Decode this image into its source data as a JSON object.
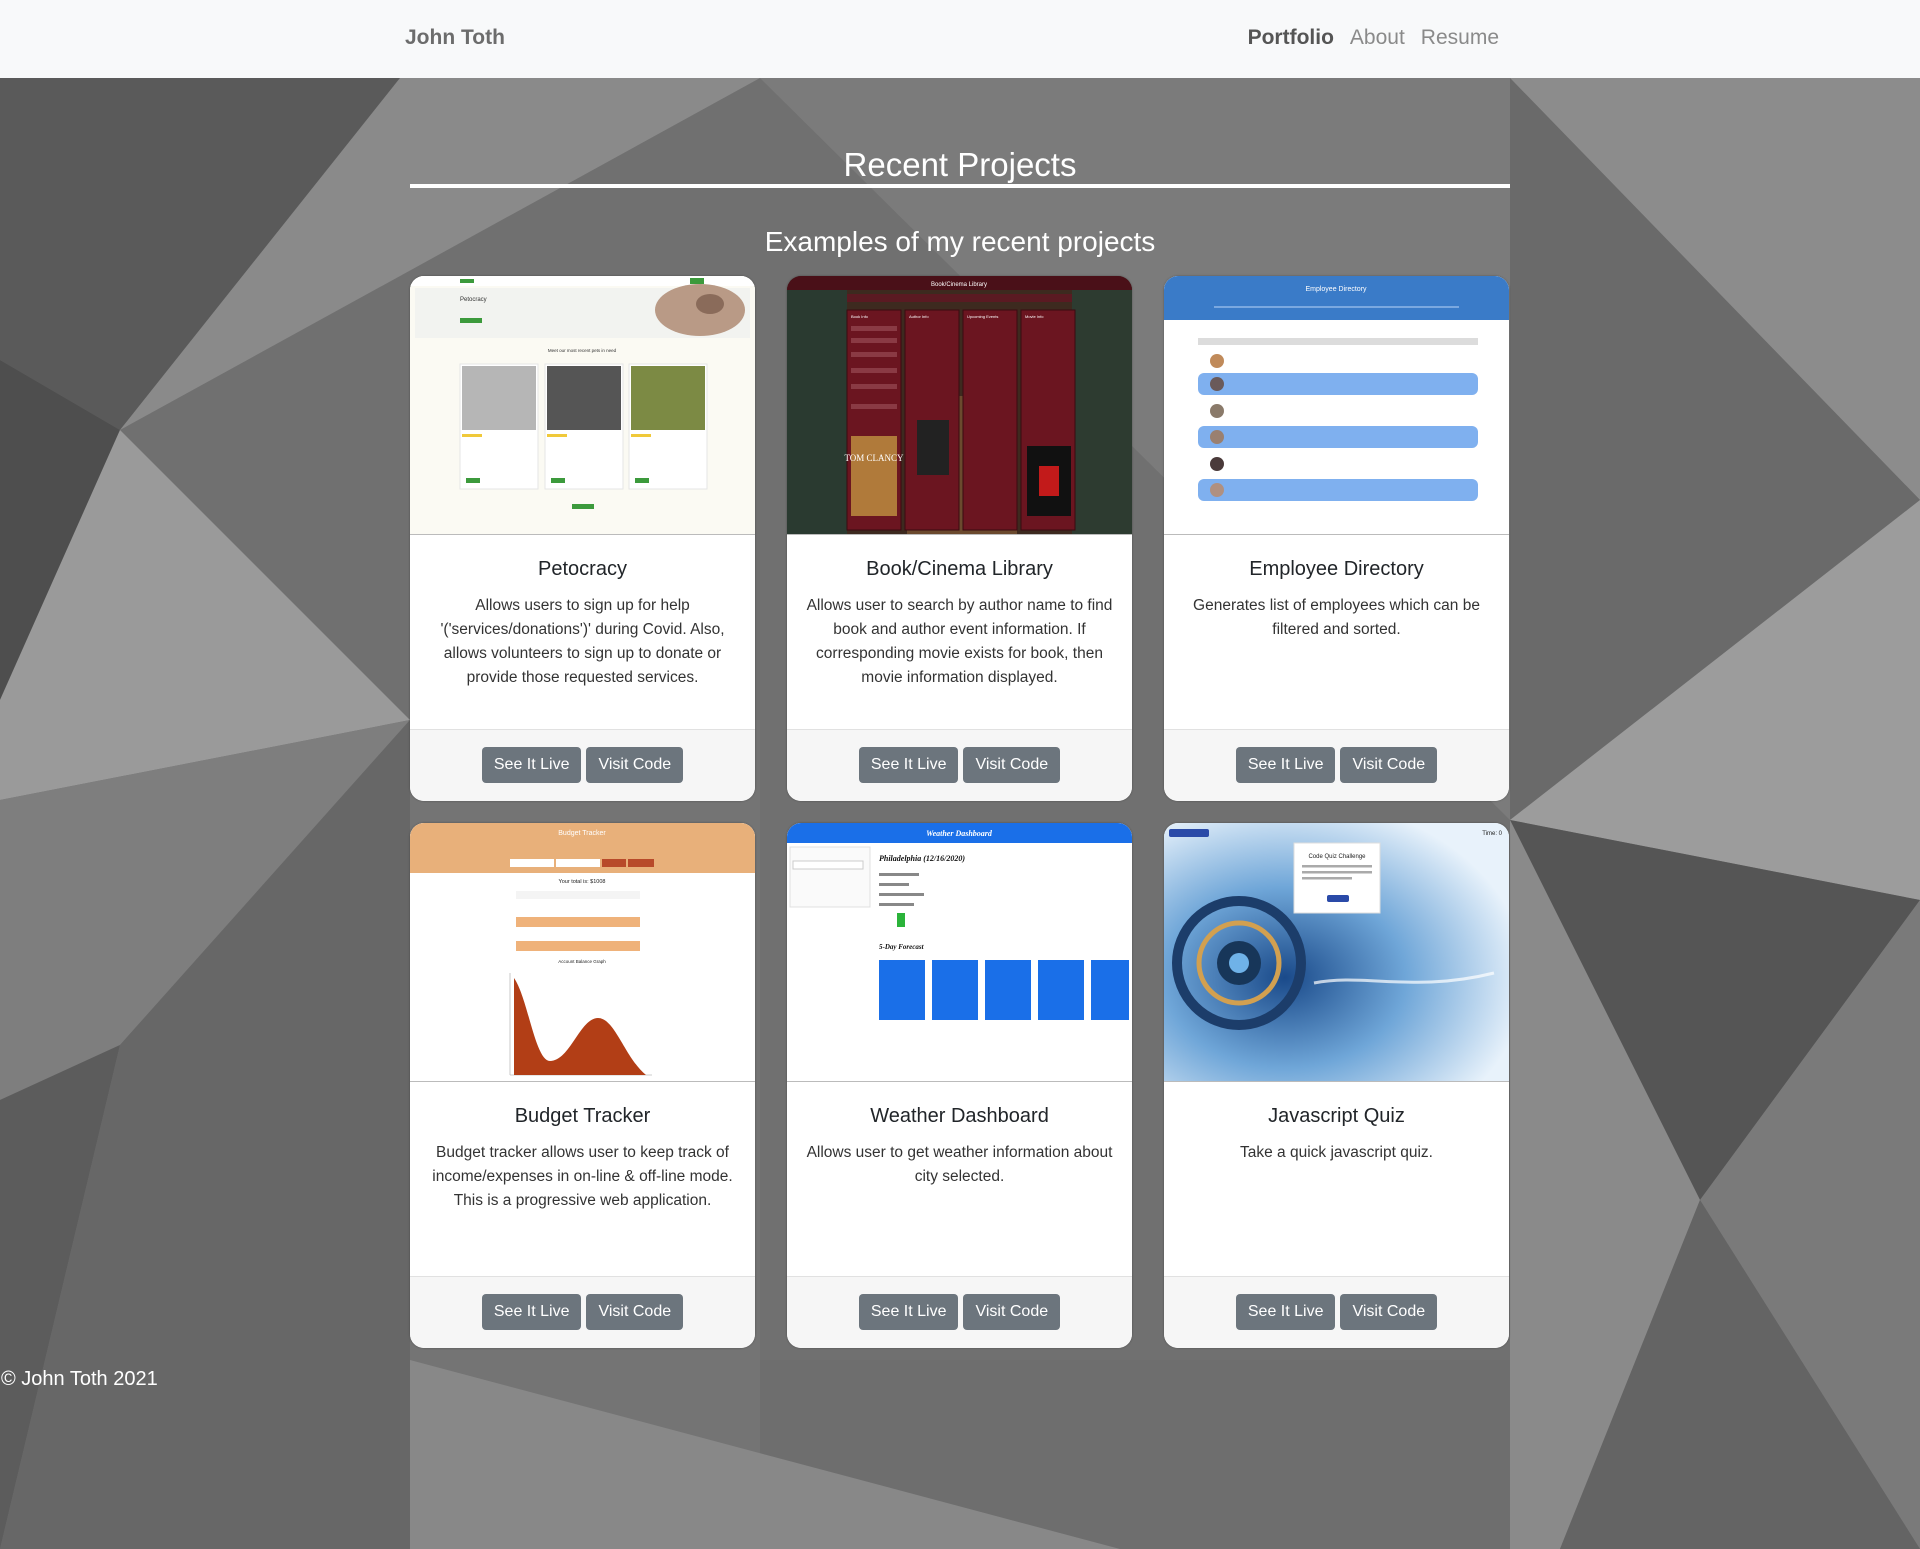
{
  "navbar": {
    "brand": "John Toth",
    "links": [
      "Portfolio",
      "About",
      "Resume"
    ]
  },
  "section": {
    "title": "Recent Projects",
    "subtitle": "Examples of my recent projects"
  },
  "projects": [
    {
      "title": "Petocracy",
      "description": "Allows users to sign up for help '('services/donations')' during Covid. Also, allows volunteers to sign up to donate or provide those requested services.",
      "thumb_texts": [
        "Petocracy",
        "Meet our most recent pets in need"
      ],
      "live_label": "See It Live",
      "code_label": "Visit Code"
    },
    {
      "title": "Book/Cinema Library",
      "description": "Allows user to search by author name to find book and author event information. If corresponding movie exists for book, then movie information displayed.",
      "thumb_texts": [
        "Book/Cinema Library",
        "Book Info",
        "Author Info",
        "Upcoming Events",
        "Movie Info",
        "TOM CLANCY"
      ],
      "live_label": "See It Live",
      "code_label": "Visit Code"
    },
    {
      "title": "Employee Directory",
      "description": "Generates list of employees which can be filtered and sorted.",
      "thumb_texts": [
        "Employee Directory"
      ],
      "live_label": "See It Live",
      "code_label": "Visit Code"
    },
    {
      "title": "Budget Tracker",
      "description": "Budget tracker allows user to keep track of income/expenses in on-line & off-line mode. This is a progressive web application.",
      "thumb_texts": [
        "Budget Tracker",
        "Your total is: $1008",
        "Account Balance Graph"
      ],
      "live_label": "See It Live",
      "code_label": "Visit Code"
    },
    {
      "title": "Weather Dashboard",
      "description": "Allows user to get weather information about city selected.",
      "thumb_texts": [
        "Weather Dashboard",
        "Philadelphia (12/16/2020)",
        "5-Day Forecast"
      ],
      "live_label": "See It Live",
      "code_label": "Visit Code"
    },
    {
      "title": "Javascript Quiz",
      "description": "Take a quick javascript quiz.",
      "thumb_texts": [
        "Code Quiz Challenge",
        "Time: 0"
      ],
      "live_label": "See It Live",
      "code_label": "Visit Code"
    }
  ],
  "footer": {
    "text": "© John Toth 2021"
  },
  "colors": {
    "navbar_bg": "#f8f9fa",
    "button_bg": "#6c757d",
    "page_bg": "#6b6b6b"
  }
}
